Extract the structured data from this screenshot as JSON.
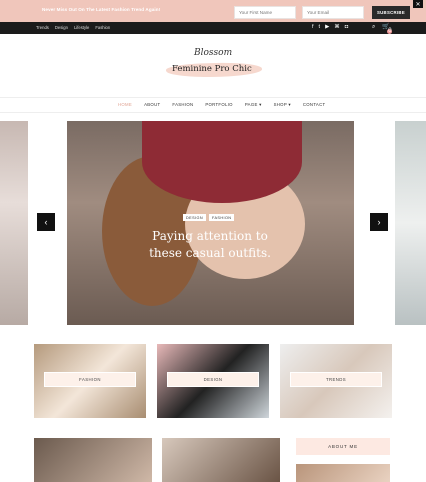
{
  "promo": {
    "text": "Never Miss Out On The Latest Fashion Trend Again!",
    "first_name_placeholder": "Your First Name",
    "email_placeholder": "Your Email",
    "subscribe_label": "SUBSCRIBE",
    "close_label": "✕"
  },
  "topbar": {
    "links": [
      "Trends",
      "Design",
      "Lifestyle",
      "Fashion"
    ],
    "social_icons": [
      "f",
      "t",
      "▶",
      "⌘",
      "◘"
    ],
    "search_glyph": "⌕",
    "cart_glyph": "🛒",
    "cart_count": "0"
  },
  "logo": {
    "script": "Blossom",
    "name": "Feminine Pro Chic"
  },
  "nav": {
    "items": [
      "HOME",
      "ABOUT",
      "FASHION",
      "PORTFOLIO",
      "PAGE ▾",
      "SHOP ▾",
      "CONTACT"
    ]
  },
  "slider": {
    "tags": [
      "DESIGN",
      "FASHION"
    ],
    "title": "Paying attention to these casual outfits.",
    "prev": "‹",
    "next": "›"
  },
  "categories": [
    {
      "label": "FASHION"
    },
    {
      "label": "DESIGN"
    },
    {
      "label": "TRENDS"
    }
  ],
  "sidebar": {
    "about_title": "ABOUT ME"
  },
  "colors": {
    "promo_bg": "#f0c6bb",
    "topbar_bg": "#1b1b1b",
    "accent": "#e0a393"
  }
}
